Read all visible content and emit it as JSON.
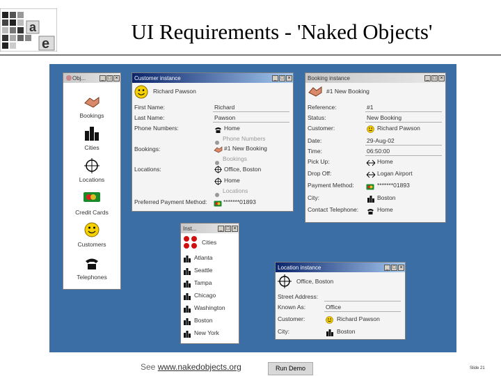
{
  "slide": {
    "title": "UI Requirements - 'Naked Objects'",
    "footer_see": "See",
    "footer_link": "www.nakedobjects.org",
    "run_button": "Run Demo",
    "slide_number": "Slide 21"
  },
  "colors": {
    "desktop": "#3a6ea5",
    "titlebar_active": "#0a246a",
    "window": "#d4d0c8"
  },
  "objects_window": {
    "title": "Obj...",
    "items": [
      {
        "label": "Bookings",
        "icon": "handshake-icon"
      },
      {
        "label": "Cities",
        "icon": "city-icon"
      },
      {
        "label": "Locations",
        "icon": "crosshair-icon"
      },
      {
        "label": "Credit Cards",
        "icon": "credit-card-icon"
      },
      {
        "label": "Customers",
        "icon": "smiley-icon"
      },
      {
        "label": "Telephones",
        "icon": "telephone-icon"
      }
    ]
  },
  "customer_window": {
    "title": "Customer instance",
    "name": "Richard Pawson",
    "fields": [
      {
        "label": "First Name:",
        "value": "Richard"
      },
      {
        "label": "Last Name:",
        "value": "Pawson"
      },
      {
        "label": "Phone Numbers:",
        "value": "Home"
      },
      {
        "label": "",
        "value": "Phone Numbers"
      },
      {
        "label": "Bookings:",
        "value": "#1 New Booking"
      },
      {
        "label": "",
        "value": "Bookings"
      },
      {
        "label": "Locations:",
        "value": "Office, Boston"
      },
      {
        "label": "",
        "value": "Home"
      },
      {
        "label": "",
        "value": "Locations"
      },
      {
        "label": "Preferred Payment Method:",
        "value": "*******01893"
      }
    ]
  },
  "booking_window": {
    "title": "Booking instance",
    "name": "#1 New Booking",
    "fields": [
      {
        "label": "Reference:",
        "value": "#1"
      },
      {
        "label": "Status:",
        "value": "New Booking"
      },
      {
        "label": "Customer:",
        "value": "Richard Pawson"
      },
      {
        "label": "Date:",
        "value": "29-Aug-02"
      },
      {
        "label": "Time:",
        "value": "06:50:00"
      },
      {
        "label": "Pick Up:",
        "value": "Home"
      },
      {
        "label": "Drop Off:",
        "value": "Logan Airport"
      },
      {
        "label": "Payment Method:",
        "value": "*******01893"
      },
      {
        "label": "City:",
        "value": "Boston"
      },
      {
        "label": "Contact Telephone:",
        "value": "Home"
      }
    ]
  },
  "cities_window": {
    "title": "Inst...",
    "header": "Cities",
    "items": [
      "Atlanta",
      "Seattle",
      "Tampa",
      "Chicago",
      "Washington",
      "Boston",
      "New York"
    ]
  },
  "location_window": {
    "title": "Location instance",
    "name": "Office, Boston",
    "fields": [
      {
        "label": "Street Address:",
        "value": ""
      },
      {
        "label": "Known As:",
        "value": "Office"
      },
      {
        "label": "Customer:",
        "value": "Richard Pawson"
      },
      {
        "label": "City:",
        "value": "Boston"
      }
    ]
  }
}
